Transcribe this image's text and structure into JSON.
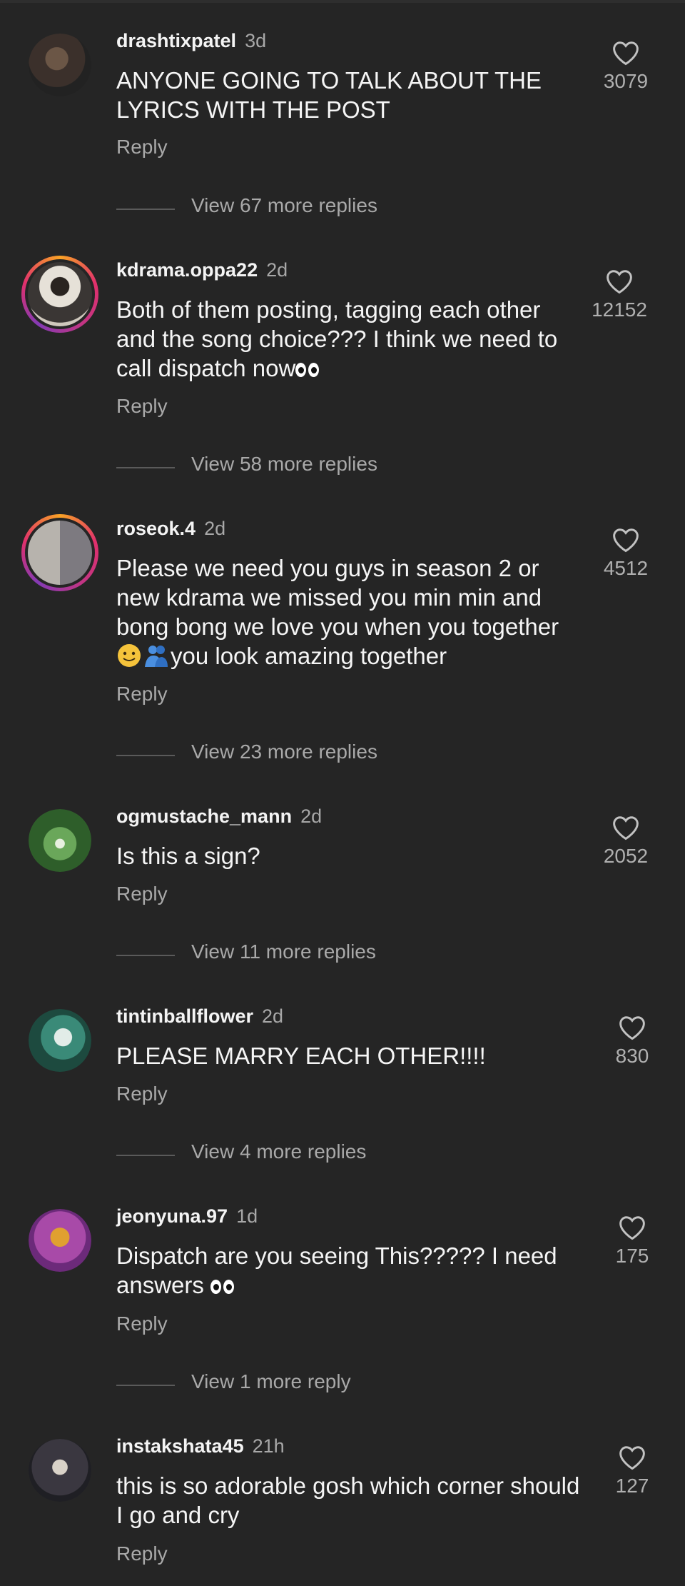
{
  "comments": [
    {
      "username": "drashtixpatel",
      "time": "3d",
      "text": "ANYONE GOING TO TALK ABOUT THE LYRICS WITH THE POST",
      "reply": "Reply",
      "likes": "3079",
      "view_replies": "View 67 more replies",
      "avatar_color": "#4a3d35"
    },
    {
      "username": "kdrama.oppa22",
      "time": "2d",
      "text": "Both of them posting, tagging each other and the song choice??? I think we need to call dispatch now",
      "reply": "Reply",
      "likes": "12152",
      "view_replies": "View 58 more replies",
      "avatar_color": "#d8d4cc",
      "story_ring": true
    },
    {
      "username": "roseok.4",
      "time": "2d",
      "text_a": "Please we need you guys in season 2 or new kdrama we missed you min min and bong bong we love you when you together",
      "text_b": "you look amazing together",
      "reply": "Reply",
      "likes": "4512",
      "view_replies": "View 23 more replies",
      "avatar_color": "#8c8a90",
      "story_ring": true
    },
    {
      "username": "ogmustache_mann",
      "time": "2d",
      "text": "Is this a sign?",
      "reply": "Reply",
      "likes": "2052",
      "view_replies": "View 11 more replies",
      "avatar_color": "#3f7a3a"
    },
    {
      "username": "tintinballflower",
      "time": "2d",
      "text": "PLEASE MARRY EACH OTHER!!!!",
      "reply": "Reply",
      "likes": "830",
      "view_replies": "View 4 more replies",
      "avatar_color": "#2f6f61"
    },
    {
      "username": "jeonyuna.97",
      "time": "1d",
      "text": "Dispatch are you seeing This????? I need answers",
      "reply": "Reply",
      "likes": "175",
      "view_replies": "View 1 more reply",
      "avatar_color": "#9b3f9c"
    },
    {
      "username": "instakshata45",
      "time": "21h",
      "text": "this is so adorable gosh which corner should I go and cry",
      "reply": "Reply",
      "likes": "127",
      "avatar_color": "#3a3a3f"
    }
  ],
  "icons": {
    "like": "heart-outline-icon",
    "eyes": "eyes-emoji-icon",
    "smile": "smiling-face-emoji-icon",
    "hug": "people-hugging-emoji-icon"
  }
}
